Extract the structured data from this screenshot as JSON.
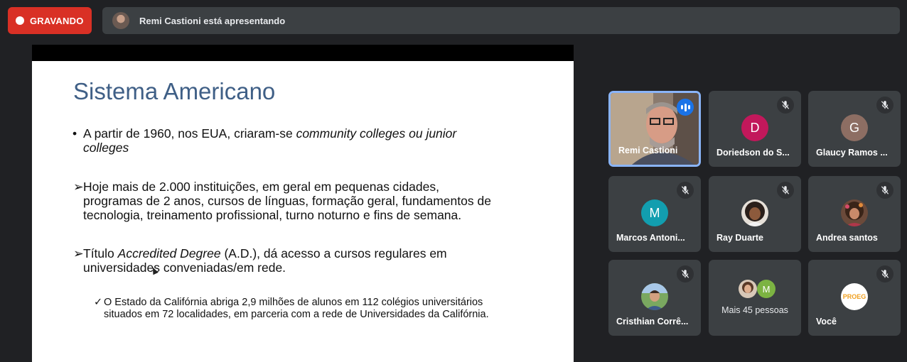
{
  "recording": {
    "label": "GRAVANDO",
    "color": "#d93025"
  },
  "presenter": {
    "text": "Remi Castioni está apresentando"
  },
  "slide": {
    "title": "Sistema Americano",
    "bullets": [
      {
        "marker": "•",
        "line1_plain": "A partir de 1960, nos EUA, criaram-se ",
        "line1_italic": "community colleges ou junior",
        "line2_italic": "colleges"
      },
      {
        "marker": "➢",
        "lines": [
          " Hoje mais de 2.000 instituições, em geral em pequenas cidades,",
          "programas de 2 anos, cursos de línguas, formação geral, fundamentos de",
          "tecnologia, treinamento profissional, turno noturno e fins de semana."
        ]
      },
      {
        "marker": "➢",
        "line1_plain": "Título ",
        "line1_italic": "Accredited Degree",
        "line1_rest": " (A.D.), dá acesso a cursos regulares em",
        "line2": "universidades conveniadas/em rede."
      },
      {
        "marker": "✓",
        "lines": [
          "O Estado da Califórnia abriga 2,9 milhões de alunos em 112 colégios universitários",
          "situados em 72 localidades, em parceria com a rede de Universidades da Califórnia."
        ]
      }
    ]
  },
  "participants": [
    {
      "name": "Remi Castioni",
      "type": "video",
      "speaking": true
    },
    {
      "name": "Doriedson do S...",
      "initial": "D",
      "avatar_color": "#c2185b",
      "muted": true
    },
    {
      "name": "Glaucy Ramos ...",
      "initial": "G",
      "avatar_color": "#8d6e63",
      "muted": true
    },
    {
      "name": "Marcos Antoni...",
      "initial": "M",
      "avatar_color": "#129eaf",
      "muted": true
    },
    {
      "name": "Ray Duarte",
      "type": "photo",
      "muted": true
    },
    {
      "name": "Andrea santos",
      "type": "photo",
      "muted": true
    },
    {
      "name": "Cristhian Corrê...",
      "type": "photo",
      "muted": true
    },
    {
      "more_label": "Mais 45 pessoas",
      "initial": "M",
      "avatar_color": "#7cb342"
    },
    {
      "name": "Você",
      "type": "logo",
      "logo_text": "PROEG",
      "muted": true
    }
  ]
}
